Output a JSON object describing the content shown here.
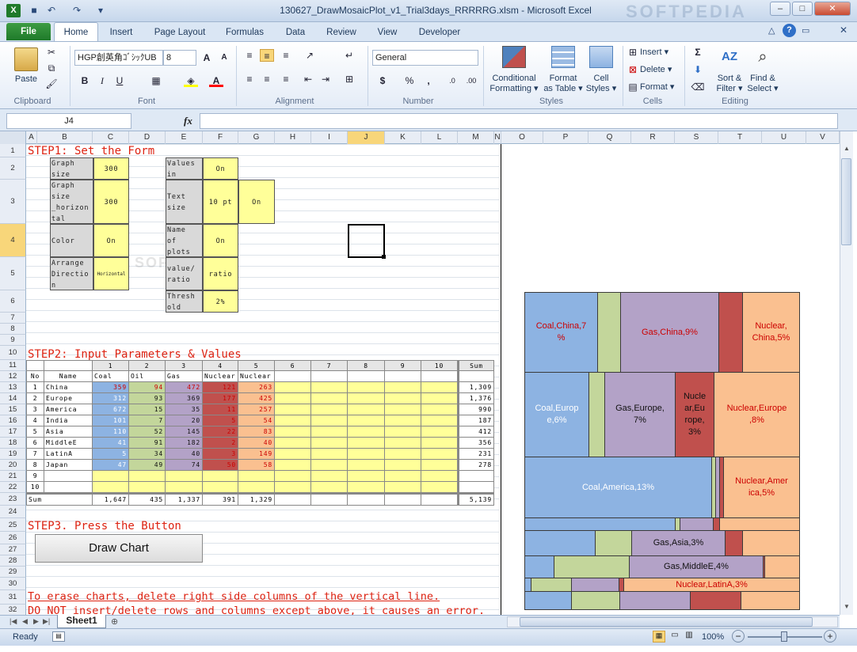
{
  "window": {
    "title": "130627_DrawMosaicPlot_v1_Trial3days_RRRRRG.xlsm - Microsoft Excel",
    "watermark": "SOFTPEDIA"
  },
  "tabs": [
    "File",
    "Home",
    "Insert",
    "Page Layout",
    "Formulas",
    "Data",
    "Review",
    "View",
    "Developer"
  ],
  "ribbon": {
    "paste": "Paste",
    "font_name": "HGP創英角ｺﾞｼｯｸUB",
    "font_size": "8",
    "number_format": "General",
    "conditional": "Conditional\nFormatting ▾",
    "format_table": "Format\nas Table ▾",
    "cell_styles": "Cell\nStyles ▾",
    "insert": "Insert ▾",
    "delete": "Delete ▾",
    "format": "Format ▾",
    "sort": "Sort &\nFilter ▾",
    "find": "Find &\nSelect ▾",
    "groups": [
      "Clipboard",
      "Font",
      "Alignment",
      "Number",
      "Styles",
      "Cells",
      "Editing"
    ]
  },
  "formula": {
    "namebox": "J4",
    "fx": "fx",
    "value": ""
  },
  "columns": [
    "A",
    "B",
    "C",
    "D",
    "E",
    "F",
    "G",
    "H",
    "I",
    "J",
    "K",
    "L",
    "M",
    "N",
    "O",
    "P",
    "Q",
    "R",
    "S",
    "T",
    "U",
    "V"
  ],
  "rows": [
    "1",
    "2",
    "3",
    "4",
    "5",
    "6",
    "7",
    "8",
    "9",
    "10",
    "11",
    "12",
    "13",
    "14",
    "15",
    "16",
    "17",
    "18",
    "19",
    "20",
    "21",
    "22",
    "23",
    "24",
    "25",
    "26",
    "27",
    "28",
    "29",
    "30",
    "31",
    "32"
  ],
  "steps": {
    "step1": "STEP1: Set the Form",
    "step2": "STEP2: Input Parameters & Values",
    "step3": "STEP3. Press the Button",
    "note1": "To erase charts, delete right side columns of the vertical line.",
    "note2": "DO NOT insert/delete rows and columns except above, it causes an error."
  },
  "form": {
    "graph_size": "Graph\nsize",
    "graph_size_val": "300",
    "graph_size_h": "Graph\nsize\n_horizon\ntal",
    "graph_size_h_val": "300",
    "color": "Color",
    "color_val": "On",
    "arrange": "Arrange\nDirectio\nn",
    "arrange_val": "Horizontal",
    "values_in": "Values\nin",
    "values_in_val": "On",
    "text_size": "Text\nsize",
    "text_size_val": "10 pt",
    "text_size_val2": "On",
    "name_plots": "Name\nof\nplots",
    "name_plots_val": "On",
    "value_ratio": "value/\nratio",
    "value_ratio_val": "ratio",
    "threshold": "Thresh\nold",
    "threshold_val": "2%"
  },
  "table": {
    "col_numbers": [
      "1",
      "2",
      "3",
      "4",
      "5",
      "6",
      "7",
      "8",
      "9",
      "10"
    ],
    "sum_label": "Sum",
    "no_label": "No",
    "name_label": "Name",
    "cat_names": [
      "Coal",
      "Oil",
      "Gas",
      "Nuclear",
      "Nuclear"
    ],
    "rows": [
      {
        "no": "1",
        "name": "China",
        "v": [
          "359",
          "94",
          "472",
          "121",
          "263"
        ],
        "sum": "1,309"
      },
      {
        "no": "2",
        "name": "Europe",
        "v": [
          "312",
          "93",
          "369",
          "177",
          "425"
        ],
        "sum": "1,376"
      },
      {
        "no": "3",
        "name": "America",
        "v": [
          "672",
          "15",
          "35",
          "11",
          "257"
        ],
        "sum": "990"
      },
      {
        "no": "4",
        "name": "India",
        "v": [
          "101",
          "7",
          "20",
          "5",
          "54"
        ],
        "sum": "187"
      },
      {
        "no": "5",
        "name": "Asia",
        "v": [
          "110",
          "52",
          "145",
          "22",
          "83"
        ],
        "sum": "412"
      },
      {
        "no": "6",
        "name": "MiddleE",
        "v": [
          "41",
          "91",
          "182",
          "2",
          "40"
        ],
        "sum": "356"
      },
      {
        "no": "7",
        "name": "LatinA",
        "v": [
          "5",
          "34",
          "40",
          "3",
          "149"
        ],
        "sum": "231"
      },
      {
        "no": "8",
        "name": "Japan",
        "v": [
          "47",
          "49",
          "74",
          "50",
          "58"
        ],
        "sum": "278"
      },
      {
        "no": "9",
        "name": "",
        "v": [
          "",
          "",
          "",
          "",
          ""
        ],
        "sum": ""
      },
      {
        "no": "10",
        "name": "",
        "v": [
          "",
          "",
          "",
          "",
          ""
        ],
        "sum": ""
      }
    ],
    "totals": [
      "1,647",
      "435",
      "1,337",
      "391",
      "1,329"
    ],
    "grand": "5,139",
    "sum_row_label": "Sum"
  },
  "button": {
    "label": "Draw Chart"
  },
  "mosaic": {
    "labels": {
      "coal_china": "Coal,China,7\n%",
      "gas_china": "Gas,China,9%",
      "nuc_china": "Nuclear,\nChina,5%",
      "coal_europe": "Coal,Europ\ne,6%",
      "gas_europe": "Gas,Europe,\n7%",
      "nuc1_europe": "Nucle\nar,Eu\nrope,\n3%",
      "nuc_europe": "Nuclear,Europe\n,8%",
      "coal_america": "Coal,America,13%",
      "nuc_america": "Nuclear,Amer\nica,5%",
      "gas_asia": "Gas,Asia,3%",
      "gas_middlee": "Gas,MiddleE,4%",
      "nuc_latina": "Nuclear,LatinA,3%"
    },
    "colors": {
      "coal": "#8db3e2",
      "oil": "#c3d69b",
      "gas": "#b3a2c7",
      "nuc1": "#c0504d",
      "nuc2": "#fac090"
    }
  },
  "sheet": {
    "tab": "Sheet1"
  },
  "status": {
    "ready": "Ready",
    "zoom": "100%"
  }
}
